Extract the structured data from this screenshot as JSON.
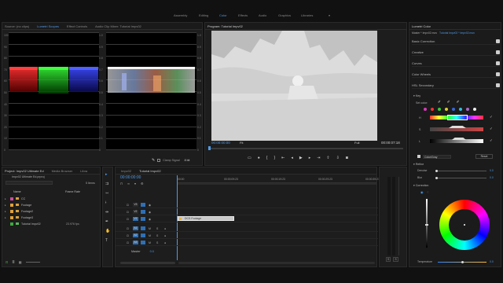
{
  "workspaces": [
    {
      "label": "Assembly",
      "active": false
    },
    {
      "label": "Editing",
      "active": false
    },
    {
      "label": "Color",
      "active": true
    },
    {
      "label": "Effects",
      "active": false
    },
    {
      "label": "Audio",
      "active": false
    },
    {
      "label": "Graphics",
      "active": false
    },
    {
      "label": "Libraries",
      "active": false
    }
  ],
  "workspace_more": "»",
  "scopes_panel": {
    "tabs": [
      "Source: (no clips)",
      "Lumetri Scopes",
      "Effect Controls",
      "Audio Clip Mixer: Tutorial Impv02"
    ],
    "active_tab": 1,
    "left_axis": [
      "100",
      "90",
      "80",
      "70",
      "60",
      "50",
      "40",
      "30",
      "20",
      "10",
      "0"
    ],
    "right_axis": [
      "1.0",
      "0.9",
      "0.8",
      "0.7",
      "0.6",
      "0.5",
      "0.4",
      "0.3",
      "0.2",
      "0.1",
      "0"
    ],
    "clamp_label": "Clamp Signal",
    "bit_depth": "8 bit"
  },
  "program_monitor": {
    "title": "Program: Tutorial Impv02",
    "timecode_left": "00:00:00:00",
    "fit_label": "Fit",
    "quality_label": "Full",
    "timecode_right": "00:00:07:18"
  },
  "project_panel": {
    "tabs": [
      "Project: Impv02 Ultimate Ed",
      "Media Browser",
      "Libra"
    ],
    "path": "Impv02 Ultimate Ed.prproj",
    "item_count": "5 Items",
    "columns": [
      "Name",
      "Frame Rate"
    ],
    "items": [
      {
        "name": "CC",
        "color": "#c84f9b",
        "rate": ""
      },
      {
        "name": "Footage",
        "color": "#e2a13a",
        "rate": ""
      },
      {
        "name": "Footage2",
        "color": "#e2a13a",
        "rate": ""
      },
      {
        "name": "Footage3",
        "color": "#e2a13a",
        "rate": ""
      },
      {
        "name": "Tutorial Impv02",
        "color": "#3fa83f",
        "rate": "23.976 fps"
      }
    ]
  },
  "timeline": {
    "tabs": [
      "Impv02",
      "Tutorial Impv02"
    ],
    "timecode": "00:00:00:00",
    "ruler": [
      ":00:00",
      "00:00:09:23",
      "00:00:19:23",
      "00:00:29:23",
      "00:00:39:23"
    ],
    "video_tracks": [
      "V3",
      "V2",
      "V1"
    ],
    "audio_tracks": [
      "A1",
      "A2",
      "A3"
    ],
    "master_label": "Master",
    "master_value": "0.0",
    "clip_label": "DCS Footage"
  },
  "audio_meter": {
    "labels": [
      "S",
      "S"
    ]
  },
  "lumetri": {
    "title": "Lumetri Color",
    "master": "Master * Impv02.mov",
    "sequence": "Tutorial Impv02 * Impv02.mov",
    "sections": [
      "Basic Correction",
      "Creative",
      "Curves",
      "Color Wheels",
      "HSL Secondary"
    ],
    "key_label": "Key",
    "set_color_label": "Set color:",
    "hsl_labels": [
      "H",
      "S",
      "L"
    ],
    "color_gray_label": "Color/Gray",
    "reset_label": "Reset",
    "refine_label": "Refine",
    "denoise_label": "Denoise",
    "denoise_value": "0.0",
    "blur_label": "Blur",
    "blur_value": "0.0",
    "correction_label": "Correction",
    "temperature_label": "Temperature",
    "temperature_value": "0.0"
  }
}
